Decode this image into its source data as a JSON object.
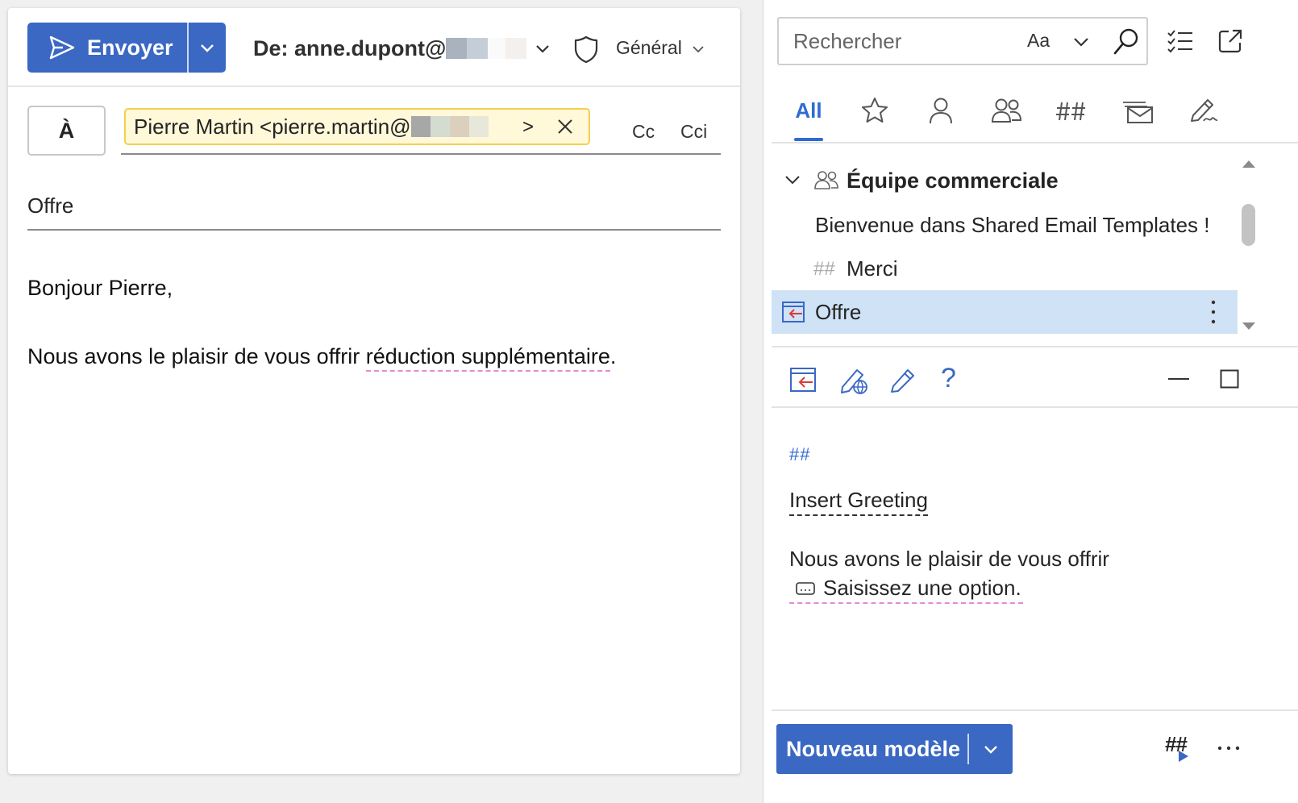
{
  "colors": {
    "accent": "#3a68c3",
    "tab_active": "#2f6bd1",
    "selected_row": "#cfe2f6",
    "chip_bg": "#fff8d9",
    "chip_border": "#f2d04f",
    "spell_underline": "#e48ad6"
  },
  "compose": {
    "send_button": {
      "label": "Envoyer",
      "icon": "send-icon",
      "dropdown_icon": "chevron-down-icon"
    },
    "from": {
      "label": "De: anne.dupont@"
    },
    "sensitivity": {
      "icon": "shield-icon",
      "label": "Général"
    },
    "to_button": {
      "label": "À"
    },
    "recipient": {
      "text": "Pierre Martin <pierre.martin@",
      "end": ">",
      "remove_icon": "close-icon"
    },
    "cc_label": "Cc",
    "bcc_label": "Cci",
    "subject": "Offre",
    "body": {
      "greeting": "Bonjour Pierre,",
      "line_start": "Nous avons le plaisir de vous offrir ",
      "line_highlight": "réduction supplémentaire",
      "line_end": "."
    }
  },
  "addin": {
    "search": {
      "placeholder": "Rechercher",
      "match_case": "Aa"
    },
    "tabs": [
      {
        "label": "All",
        "active": true
      },
      {
        "icon": "star-icon"
      },
      {
        "icon": "person-icon"
      },
      {
        "icon": "people-icon"
      },
      {
        "icon": "macro-hash-icon"
      },
      {
        "icon": "mail-stack-icon"
      },
      {
        "icon": "pen-sign-icon"
      }
    ],
    "team": {
      "name": "Équipe commerciale",
      "icon": "team-icon"
    },
    "templates": [
      {
        "label": "Bienvenue dans Shared Email Templates !"
      },
      {
        "prefix": "##",
        "label": "Merci"
      },
      {
        "label": "Offre",
        "selected": true
      }
    ],
    "actions": {
      "help": "?"
    },
    "preview": {
      "hash": "##",
      "macro": "Insert Greeting",
      "line1": "Nous avons le plaisir de vous offrir",
      "option": "Saisissez une option."
    },
    "new_template_button": "Nouveau modèle",
    "run_macro_hash": "##"
  }
}
